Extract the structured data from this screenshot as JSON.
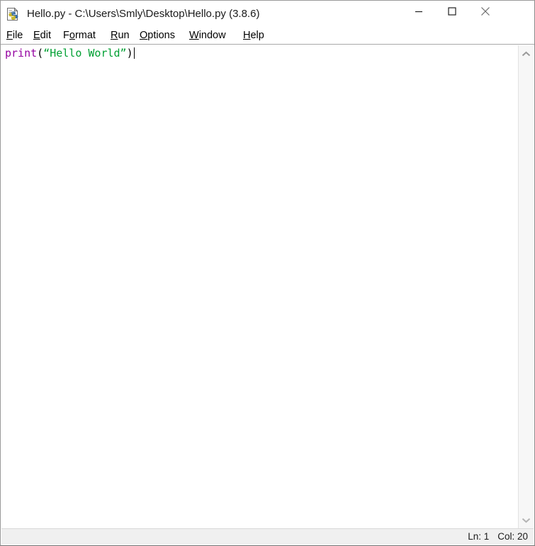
{
  "window": {
    "title": "Hello.py - C:\\Users\\Smly\\Desktop\\Hello.py (3.8.6)",
    "icon": "python-file-icon",
    "controls": {
      "minimize": "minimize-icon",
      "maximize": "maximize-icon",
      "close": "close-icon"
    }
  },
  "menubar": {
    "items": [
      {
        "label": "File",
        "mnemonic": "F",
        "before": "",
        "after": "ile"
      },
      {
        "label": "Edit",
        "mnemonic": "E",
        "before": "",
        "after": "dit"
      },
      {
        "label": "Format",
        "mnemonic": "o",
        "before": "F",
        "after": "rmat"
      },
      {
        "label": "Run",
        "mnemonic": "R",
        "before": "",
        "after": "un"
      },
      {
        "label": "Options",
        "mnemonic": "O",
        "before": "",
        "after": "ptions"
      },
      {
        "label": "Window",
        "mnemonic": "W",
        "before": "",
        "after": "indow"
      },
      {
        "label": "Help",
        "mnemonic": "H",
        "before": "",
        "after": "elp"
      }
    ]
  },
  "editor": {
    "text": "print(“Hello World”)",
    "tokens": {
      "keyword": "print",
      "open_paren": "(",
      "string": "“Hello World”",
      "close_paren": ")"
    },
    "colors": {
      "keyword": "#9400a0",
      "string": "#00a033",
      "punctuation": "#000000",
      "background": "#ffffff"
    }
  },
  "scrollbar": {
    "up_arrow": "chevron-up-icon",
    "down_arrow": "chevron-down-icon"
  },
  "statusbar": {
    "line": "Ln: 1",
    "column": "Col: 20"
  }
}
